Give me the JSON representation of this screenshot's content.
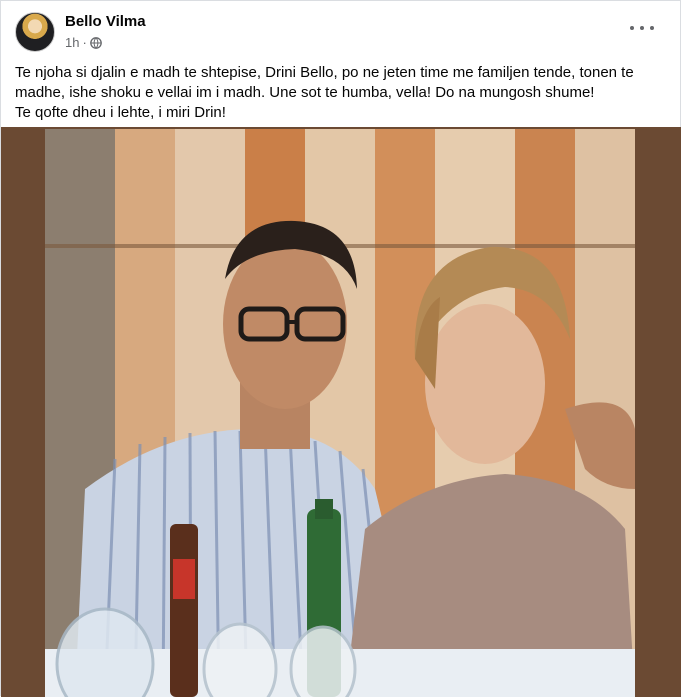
{
  "post": {
    "author": "Bello Vilma",
    "time": "1h",
    "dot": "·",
    "privacy_icon": "globe-icon",
    "more_icon": "more-options-icon",
    "text_lines": [
      "Te njoha si djalin e madh te shtepise, Drini Bello, po ne jeten time me familjen tende, tonen te madhe, ishe shoku e vellai im i madh. Une sot te humba, vella! Do na mungosh shume!",
      "Te qofte dheu i lehte, i miri Drin!"
    ]
  },
  "photo": {
    "background_color": "#6b4a33",
    "curtain_colors": [
      "#e9c7a3",
      "#d98b52",
      "#f2ddc4",
      "#c97a44"
    ]
  }
}
